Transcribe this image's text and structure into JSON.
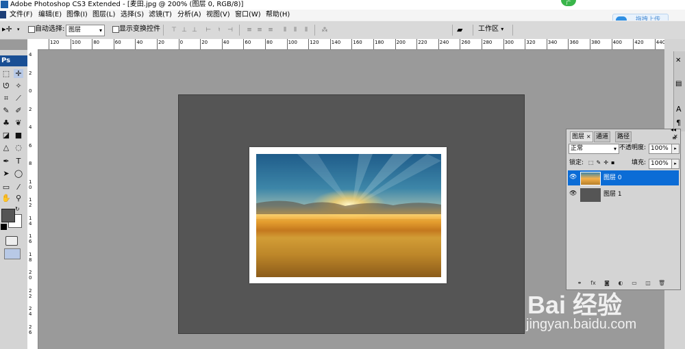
{
  "window": {
    "title": "Adobe Photoshop CS3 Extended - [麦田.jpg @ 200% (图层 0, RGB/8)]",
    "badge_text": "广"
  },
  "menu": {
    "items": [
      "文件(F)",
      "编辑(E)",
      "图像(I)",
      "图层(L)",
      "选择(S)",
      "滤镜(T)",
      "分析(A)",
      "视图(V)",
      "窗口(W)",
      "帮助(H)"
    ]
  },
  "upload": {
    "label": "拖拽上传"
  },
  "options_bar": {
    "auto_select_label": "自动选择:",
    "auto_select_value": "图层",
    "show_transform_label": "显示变换控件",
    "workspace_label": "工作区"
  },
  "ruler": {
    "top_labels": [
      "120",
      "100",
      "80",
      "60",
      "40",
      "20",
      "0",
      "20",
      "40",
      "60",
      "80",
      "100",
      "120",
      "140",
      "160",
      "180",
      "200",
      "220",
      "240",
      "260",
      "280",
      "300",
      "320",
      "340",
      "360",
      "380",
      "400",
      "420",
      "440"
    ],
    "left_labels": [
      "4",
      "2",
      "0",
      "2",
      "4",
      "6",
      "8",
      "1 0",
      "1 2",
      "1 4",
      "1 6",
      "1 8",
      "2 0",
      "2 2",
      "2 4",
      "2 6"
    ]
  },
  "toolbox": {
    "header": "Ps"
  },
  "layers_panel": {
    "tabs": [
      "图层",
      "通道",
      "路径"
    ],
    "blend_mode": "正常",
    "opacity_label": "不透明度:",
    "opacity_value": "100%",
    "lock_label": "锁定:",
    "fill_label": "填充:",
    "fill_value": "100%",
    "layers": [
      {
        "name": "图层 0",
        "selected": true
      },
      {
        "name": "图层 1",
        "selected": false
      }
    ]
  },
  "watermark": {
    "logo": "Bai 经验",
    "url": "jingyan.baidu.com"
  },
  "colors": {
    "selection_blue": "#0b6cd6",
    "canvas_bg": "#555555",
    "workspace_bg": "#9a9a9a"
  }
}
